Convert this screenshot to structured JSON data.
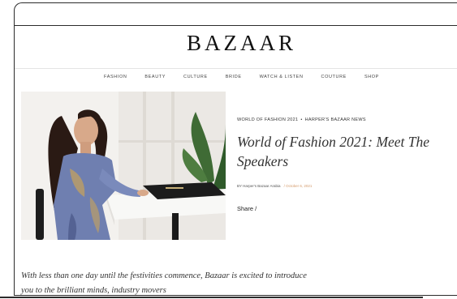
{
  "site": {
    "logo": "BAZAAR"
  },
  "nav": {
    "items": [
      "FASHION",
      "BEAUTY",
      "CULTURE",
      "BRIDE",
      "WATCH & LISTEN",
      "COUTURE",
      "SHOP"
    ]
  },
  "article": {
    "category_1": "WORLD OF FASHION 2021",
    "separator": "•",
    "category_2": "HARPER'S BAZAAR NEWS",
    "title": "World of Fashion 2021: Meet The Speakers",
    "byline": "BY Harper's Bazaar Arabia",
    "date": "/ October 6, 2021",
    "share_label": "Share /",
    "intro": "With less than one day until the festivities commence, Bazaar is excited to introduce you to the brilliant minds, industry movers"
  },
  "colors": {
    "accent_date": "#d49a6a",
    "frame": "#2b2b2b",
    "dress": "#6f7fb0"
  },
  "icons": {
    "hero_image": "woman-seated-at-desk-photo"
  }
}
